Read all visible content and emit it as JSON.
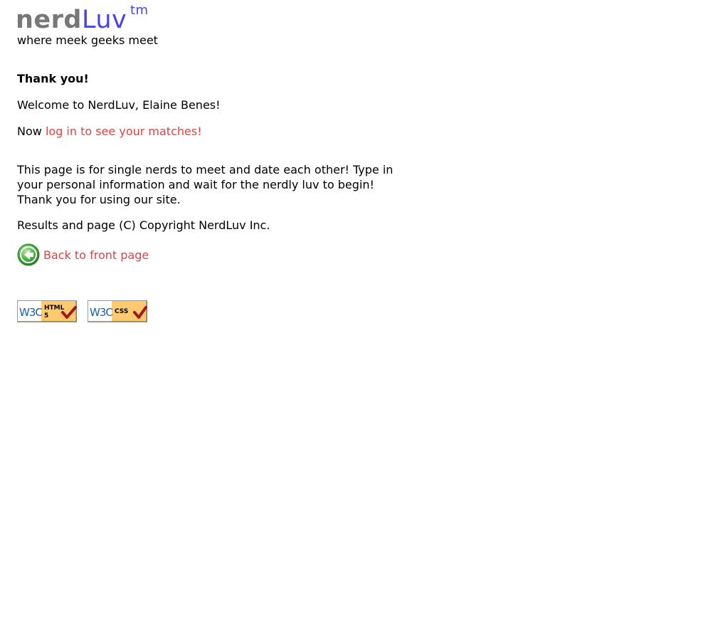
{
  "banner": {
    "logo_nerd": "nerd",
    "logo_luv": "Luv",
    "logo_tm": "tm",
    "tagline": "where meek geeks meet"
  },
  "main": {
    "heading": "Thank you!",
    "welcome": "Welcome to NerdLuv, Elaine Benes!",
    "now_prefix": "Now ",
    "login_link": "log in to see your matches!"
  },
  "footer": {
    "about": "This page is for single nerds to meet and date each other! Type in your personal information and wait for the nerdly luv to begin! Thank you for using our site.",
    "copyright": "Results and page (C) Copyright NerdLuv Inc.",
    "back_link": "Back to front page",
    "back_icon": "back-arrow-icon",
    "badges": [
      {
        "icon": "w3c-html5-badge",
        "w3c": "W3C",
        "label_1": "HTML",
        "label_2": "5"
      },
      {
        "icon": "w3c-css-badge",
        "w3c": "W3C",
        "label_1": "CSS",
        "label_2": ""
      }
    ]
  },
  "colors": {
    "link": "#e83e3e",
    "logo_grey": "#777777",
    "logo_blue": "#4444ee",
    "badge_yellow": "#fdcb6e",
    "w3c_blue": "#1b5fa8",
    "check_red": "#a01818",
    "icon_green": "#3aa53a"
  }
}
